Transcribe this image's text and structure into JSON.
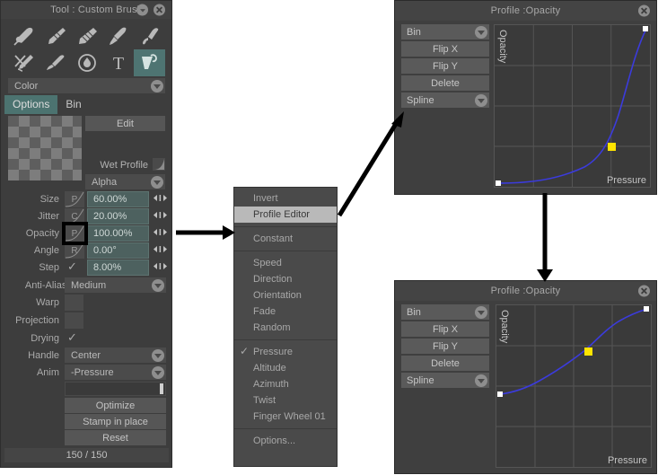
{
  "tool_panel": {
    "title": "Tool : Custom Brush",
    "title_chevron_icon": "chevron-down-icon",
    "close_icon": "close-icon",
    "tool_icons": [
      "pen-nib-icon",
      "pencil-icon",
      "marker-icon",
      "airbrush-icon",
      "ribbon-brush-icon",
      "scissors-pen-icon",
      "paint-brush-icon",
      "water-drop-icon",
      "text-tool-icon",
      "palette-knife-icon"
    ],
    "selected_tool_index": 9,
    "color_combo": {
      "value": "Color",
      "chevron_icon": "chevron-down-icon"
    },
    "tabs": [
      {
        "label": "Options",
        "active": true
      },
      {
        "label": "Bin",
        "active": false
      }
    ],
    "edit_button": "Edit",
    "wet_profile_label": "Wet Profile",
    "alpha_combo": {
      "value": "Alpha",
      "chevron_icon": "chevron-down-icon"
    },
    "sliders": [
      {
        "label": "Size",
        "glyph": "P",
        "value": "60.00%"
      },
      {
        "label": "Jitter",
        "glyph": "C",
        "value": "20.00%"
      },
      {
        "label": "Opacity",
        "glyph": "P",
        "value": "100.00%"
      },
      {
        "label": "Angle",
        "glyph": "R",
        "value": "0.00°"
      },
      {
        "label": "Step",
        "glyph": "✓",
        "value": "8.00%"
      }
    ],
    "rows": [
      {
        "label": "Anti-Aliasing",
        "type": "combo",
        "value": "Medium"
      },
      {
        "label": "Warp",
        "type": "swatch",
        "value": ""
      },
      {
        "label": "Projection",
        "type": "swatch",
        "value": ""
      },
      {
        "label": "Drying",
        "type": "check",
        "value": "✓"
      },
      {
        "label": "Handle",
        "type": "combo",
        "value": "Center"
      },
      {
        "label": "Anim",
        "type": "combo",
        "value": "-Pressure"
      }
    ],
    "action_buttons": [
      "Optimize",
      "Stamp in place",
      "Reset"
    ],
    "status": "150 / 150",
    "highlight_target": "opacity-profile-button"
  },
  "context_menu": {
    "groups": [
      {
        "items": [
          {
            "label": "Invert",
            "checked": false,
            "highlighted": false
          },
          {
            "label": "Profile Editor",
            "checked": false,
            "highlighted": true
          }
        ]
      },
      {
        "items": [
          {
            "label": "Constant",
            "checked": false,
            "highlighted": false
          }
        ]
      },
      {
        "items": [
          {
            "label": "Speed",
            "checked": false,
            "highlighted": false
          },
          {
            "label": "Direction",
            "checked": false,
            "highlighted": false
          },
          {
            "label": "Orientation",
            "checked": false,
            "highlighted": false
          },
          {
            "label": "Fade",
            "checked": false,
            "highlighted": false
          },
          {
            "label": "Random",
            "checked": false,
            "highlighted": false
          }
        ]
      },
      {
        "items": [
          {
            "label": "Pressure",
            "checked": true,
            "highlighted": false
          },
          {
            "label": "Altitude",
            "checked": false,
            "highlighted": false
          },
          {
            "label": "Azimuth",
            "checked": false,
            "highlighted": false
          },
          {
            "label": "Twist",
            "checked": false,
            "highlighted": false
          },
          {
            "label": "Finger Wheel 01",
            "checked": false,
            "highlighted": false
          }
        ]
      },
      {
        "items": [
          {
            "label": "Options...",
            "checked": false,
            "highlighted": false
          }
        ]
      }
    ]
  },
  "profile_top": {
    "title": "Profile :Opacity",
    "close_icon": "close-icon",
    "bin_combo": {
      "value": "Bin",
      "chevron_icon": "chevron-down-icon"
    },
    "buttons": [
      "Flip X",
      "Flip Y",
      "Delete"
    ],
    "mode_combo": {
      "value": "Spline",
      "chevron_icon": "chevron-down-icon"
    },
    "y_axis_label": "Opacity",
    "x_axis_label": "Pressure"
  },
  "profile_bottom": {
    "title": "Profile :Opacity",
    "close_icon": "close-icon",
    "bin_combo": {
      "value": "Bin",
      "chevron_icon": "chevron-down-icon"
    },
    "buttons": [
      "Flip X",
      "Flip Y",
      "Delete"
    ],
    "mode_combo": {
      "value": "Spline",
      "chevron_icon": "chevron-down-icon"
    },
    "y_axis_label": "Opacity",
    "x_axis_label": "Pressure"
  },
  "chart_data": [
    {
      "id": "profile-top-curve",
      "type": "line",
      "title": "Profile :Opacity",
      "xlabel": "Pressure",
      "ylabel": "Opacity",
      "xlim": [
        0,
        1
      ],
      "ylim": [
        0,
        1
      ],
      "grid": true,
      "grid_divisions": 4,
      "curve_color": "#3b3bdc",
      "shape": "exponential ease-in",
      "points": [
        {
          "x": 0.0,
          "y": 0.0,
          "handle": "endpoint",
          "color": "#ffffff"
        },
        {
          "x": 0.75,
          "y": 0.25,
          "handle": "control",
          "color": "#ffe400"
        },
        {
          "x": 1.0,
          "y": 1.0,
          "handle": "endpoint",
          "color": "#ffffff"
        }
      ],
      "sampled": [
        {
          "x": 0.0,
          "y": 0.0
        },
        {
          "x": 0.1,
          "y": 0.005
        },
        {
          "x": 0.2,
          "y": 0.014
        },
        {
          "x": 0.3,
          "y": 0.03
        },
        {
          "x": 0.4,
          "y": 0.055
        },
        {
          "x": 0.5,
          "y": 0.09
        },
        {
          "x": 0.6,
          "y": 0.14
        },
        {
          "x": 0.7,
          "y": 0.205
        },
        {
          "x": 0.75,
          "y": 0.25
        },
        {
          "x": 0.8,
          "y": 0.32
        },
        {
          "x": 0.85,
          "y": 0.43
        },
        {
          "x": 0.9,
          "y": 0.57
        },
        {
          "x": 0.95,
          "y": 0.76
        },
        {
          "x": 1.0,
          "y": 1.0
        }
      ]
    },
    {
      "id": "profile-bottom-curve",
      "type": "line",
      "title": "Profile :Opacity",
      "xlabel": "Pressure",
      "ylabel": "Opacity",
      "xlim": [
        0,
        1
      ],
      "ylim": [
        0,
        1
      ],
      "grid": true,
      "grid_divisions": 4,
      "curve_color": "#3b3bdc",
      "shape": "s-curve",
      "points": [
        {
          "x": 0.0,
          "y": 0.45,
          "handle": "endpoint",
          "color": "#ffffff"
        },
        {
          "x": 0.6,
          "y": 0.72,
          "handle": "control",
          "color": "#ffe400"
        },
        {
          "x": 1.0,
          "y": 1.0,
          "handle": "endpoint",
          "color": "#ffffff"
        }
      ],
      "sampled": [
        {
          "x": 0.0,
          "y": 0.45
        },
        {
          "x": 0.1,
          "y": 0.468
        },
        {
          "x": 0.2,
          "y": 0.5
        },
        {
          "x": 0.3,
          "y": 0.545
        },
        {
          "x": 0.4,
          "y": 0.598
        },
        {
          "x": 0.5,
          "y": 0.655
        },
        {
          "x": 0.6,
          "y": 0.72
        },
        {
          "x": 0.7,
          "y": 0.805
        },
        {
          "x": 0.8,
          "y": 0.885
        },
        {
          "x": 0.9,
          "y": 0.945
        },
        {
          "x": 1.0,
          "y": 1.0
        }
      ]
    }
  ],
  "annotations": {
    "arrows": [
      {
        "name": "arrow-opacity-to-menu",
        "from": [
          195,
          259
        ],
        "to": [
          258,
          259
        ]
      },
      {
        "name": "arrow-menu-to-profile",
        "from": [
          378,
          240
        ],
        "to": [
          447,
          130
        ]
      },
      {
        "name": "arrow-top-to-bottom",
        "from": [
          607,
          218
        ],
        "to": [
          607,
          312
        ]
      }
    ],
    "color": "#000000"
  }
}
